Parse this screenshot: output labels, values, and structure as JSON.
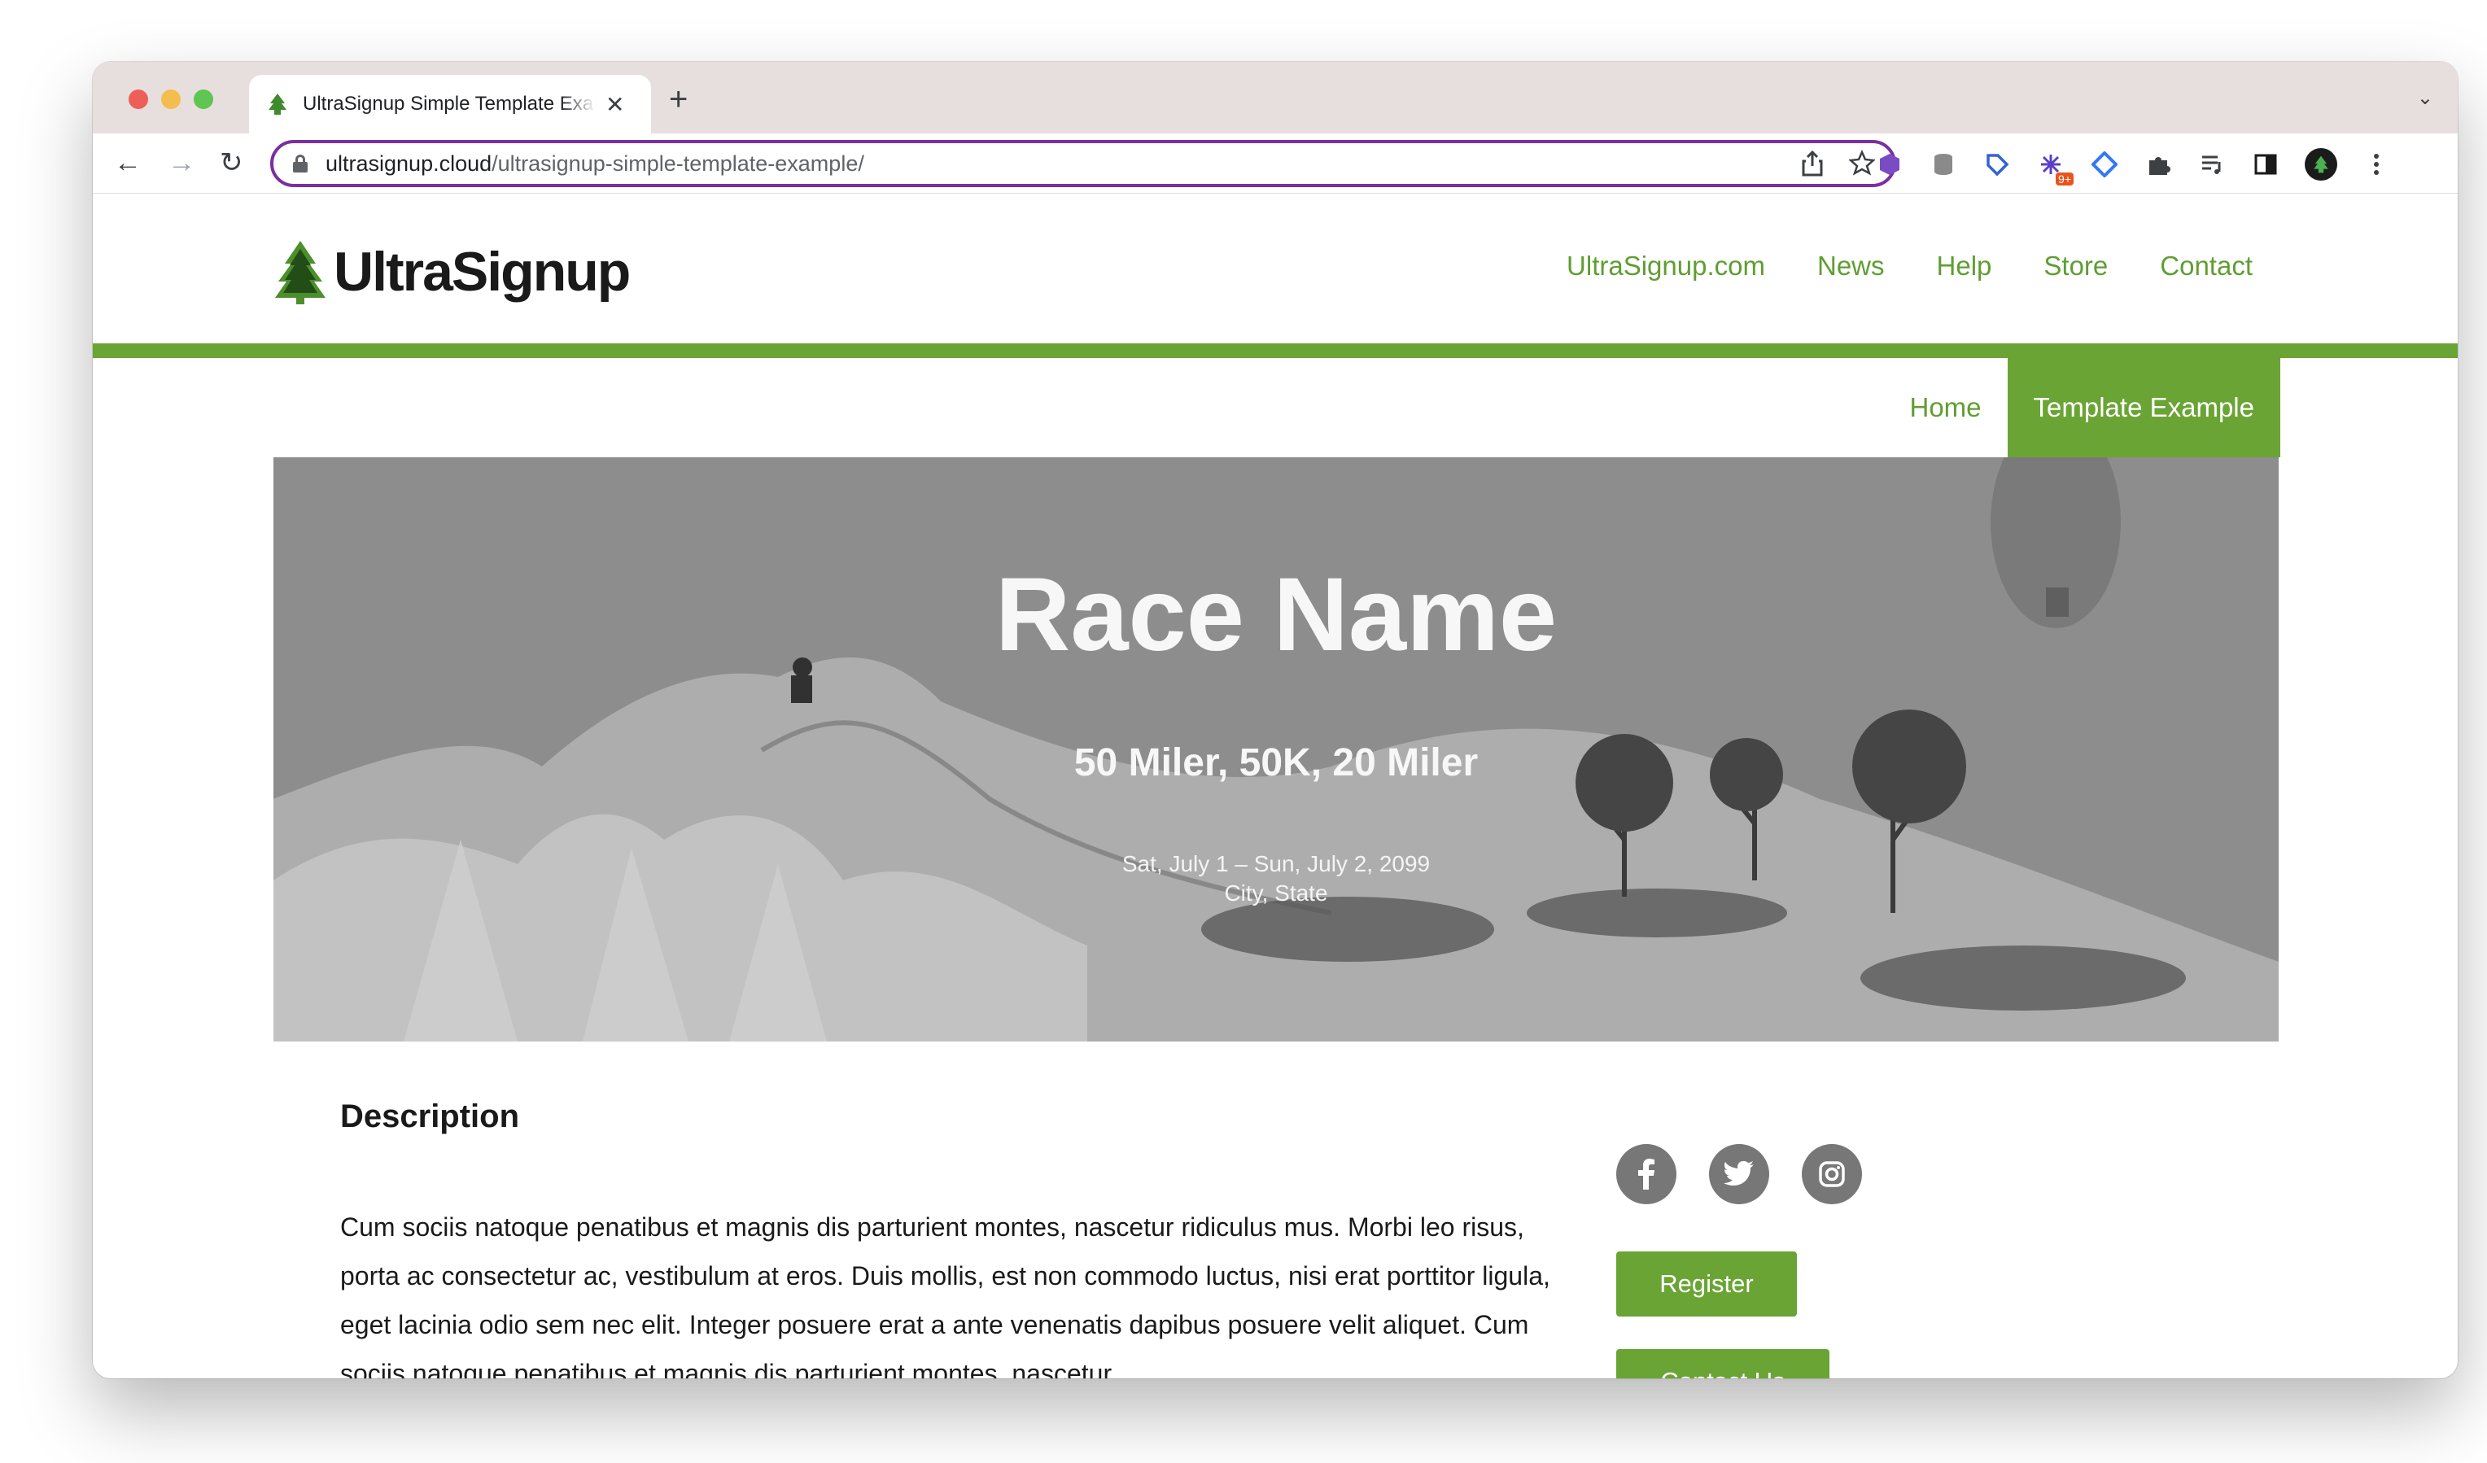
{
  "browser": {
    "tab_title": "UltraSignup Simple Template Example",
    "tab_close": "✕",
    "new_tab": "+",
    "tab_menu": "⌄",
    "url_domain": "ultrasignup.cloud",
    "url_path": "/ultrasignup-simple-template-example/",
    "back": "←",
    "forward": "→",
    "reload": "↻",
    "extension_badge": "9+"
  },
  "site": {
    "logo_text": "UltraSignup",
    "nav": [
      "UltraSignup.com",
      "News",
      "Help",
      "Store",
      "Contact"
    ],
    "subnav_home": "Home",
    "subnav_active": "Template Example",
    "accent_color": "#6aa434"
  },
  "hero": {
    "title": "Race Name",
    "distances": "50 Miler, 50K, 20 Miler",
    "dates": "Sat, July 1 – Sun, July 2, 2099",
    "location": "City, State"
  },
  "content": {
    "description_heading": "Description",
    "description_text": "Cum sociis natoque penatibus et magnis dis parturient montes, nascetur ridiculus mus. Morbi leo risus, porta ac consectetur ac, vestibulum at eros. Duis mollis, est non commodo luctus, nisi erat porttitor ligula, eget lacinia odio sem nec elit. Integer posuere erat a ante venenatis dapibus posuere velit aliquet. Cum sociis natoque penatibus et magnis dis parturient montes, nascetur",
    "register_label": "Register",
    "contact_label": "Contact Us"
  }
}
